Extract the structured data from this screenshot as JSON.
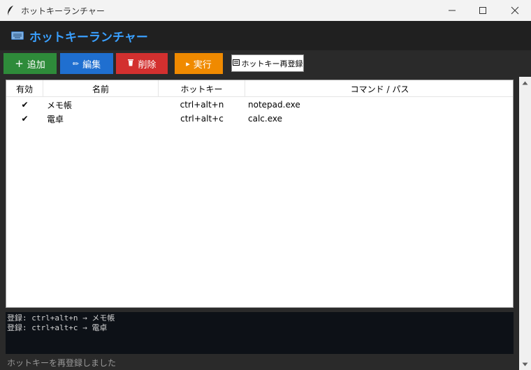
{
  "window": {
    "title": "ホットキーランチャー",
    "icon": "feather-icon",
    "controls": [
      "minimize-icon",
      "maximize-icon",
      "close-icon"
    ]
  },
  "header": {
    "icon": "keyboard-icon",
    "title": "ホットキーランチャー",
    "title_color": "#3aa0ff",
    "background": "#202020"
  },
  "toolbar": {
    "add_label": "追加",
    "add_icon": "+",
    "edit_label": "編集",
    "edit_icon": "✏",
    "delete_label": "削除",
    "delete_icon": "🗑",
    "run_label": "実行",
    "run_icon": "▸",
    "rereg_label": "ホットキー再登録",
    "rereg_icon": "⌨",
    "colors": {
      "add": "#2e8b3a",
      "edit": "#1f6fd0",
      "delete": "#d3302f",
      "run": "#f08a00"
    }
  },
  "table": {
    "headers": [
      "有効",
      "名前",
      "ホットキー",
      "コマンド / パス"
    ],
    "rows": [
      {
        "enabled": "✔",
        "name": "メモ帳",
        "hotkey": "ctrl+alt+n",
        "command": "notepad.exe"
      },
      {
        "enabled": "✔",
        "name": "電卓",
        "hotkey": "ctrl+alt+c",
        "command": "calc.exe"
      }
    ]
  },
  "log": {
    "lines": [
      "登録: ctrl+alt+n → メモ帳",
      "登録: ctrl+alt+c → 電卓"
    ]
  },
  "status": {
    "text": "ホットキーを再登録しました"
  }
}
